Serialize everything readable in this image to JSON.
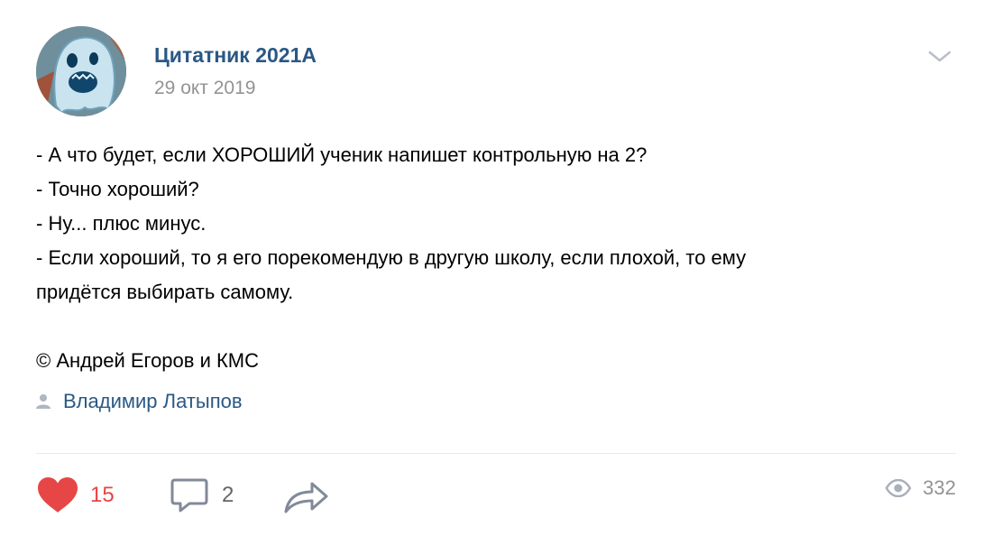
{
  "post": {
    "author": {
      "name": "Цитатник 2021А",
      "avatar_icon": "community-avatar"
    },
    "date": "29 окт 2019",
    "text_lines": [
      "- А что будет, если ХОРОШИЙ ученик напишет контрольную на 2?",
      "- Точно хороший?",
      "- Ну... плюс минус.",
      "- Если хороший, то я его порекомендую в другую школу, если плохой, то ему",
      "придётся выбирать самому."
    ],
    "credit": "© Андрей Егоров и КМС",
    "signer": {
      "name": "Владимир Латыпов",
      "icon": "user-icon"
    }
  },
  "actions": {
    "likes": "15",
    "comments": "2",
    "views": "332"
  },
  "colors": {
    "link": "#2a5885",
    "like_red": "#e64646",
    "muted": "#939393",
    "icon_gray": "#828a99",
    "divider": "#e7e8ec"
  }
}
